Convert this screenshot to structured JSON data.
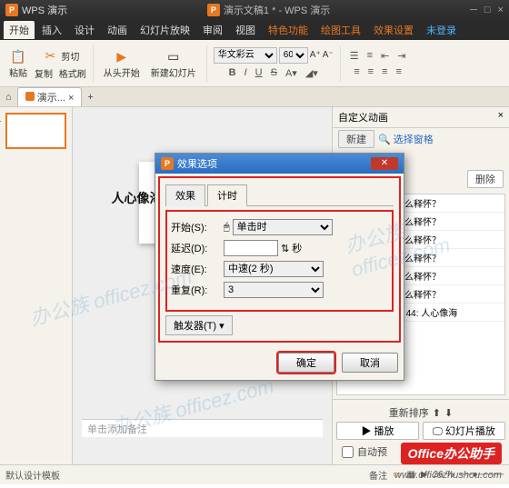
{
  "app": {
    "name": "WPS 演示",
    "doc_title": "演示文稿1 * - WPS 演示"
  },
  "menu": [
    "开始",
    "插入",
    "设计",
    "动画",
    "幻灯片放映",
    "审阅",
    "视图",
    "特色功能",
    "绘图工具",
    "效果设置",
    "未登录"
  ],
  "ribbon": {
    "paste": "粘贴",
    "cut": "剪切",
    "copy": "复制",
    "fmtbrush": "格式刷",
    "fromhead": "从头开始",
    "newslide": "新建幻灯片",
    "font_name": "华文彩云",
    "font_size": "60",
    "bold": "B",
    "italic": "I",
    "underline": "U",
    "strike": "S"
  },
  "tab": {
    "doc": "演示..."
  },
  "pane": {
    "title": "自定义动画",
    "close": "×",
    "newbtn": "新建",
    "selpane": "选择窗格",
    "custom": "自定义动画",
    "delete": "删除",
    "items": [
      "人心像海，要怎么释怀？",
      "人心像海，要怎么释怀？",
      "人心像海，要怎么释怀？",
      "人心像海，要怎么释怀？",
      "人心像海，要怎么释怀？",
      "人心像海，要怎么释怀？",
      "文本框 44: 人心像海"
    ],
    "reorder": "重新排序",
    "play": "播放",
    "slideshow": "幻灯片播放",
    "autoplay": "自动预"
  },
  "dialog": {
    "title": "效果选项",
    "tab_effect": "效果",
    "tab_timing": "计时",
    "start_lbl": "开始(S):",
    "start_val": "单击时",
    "delay_lbl": "延迟(D):",
    "delay_val": "",
    "delay_unit": "秒",
    "speed_lbl": "速度(E):",
    "speed_val": "中速(2 秒)",
    "repeat_lbl": "重复(R):",
    "repeat_val": "3",
    "trigger": "触发器(T) ▾",
    "ok": "确定",
    "cancel": "取消"
  },
  "canvas": {
    "slide_text": "人心像海,",
    "notes": "单击添加备注"
  },
  "status": {
    "template": "默认设计模板",
    "note": "备注",
    "zoom": "26 %"
  },
  "watermark": "办公族 officez.com",
  "brand": "Office办公助手",
  "url": "www.officezhushou.com"
}
